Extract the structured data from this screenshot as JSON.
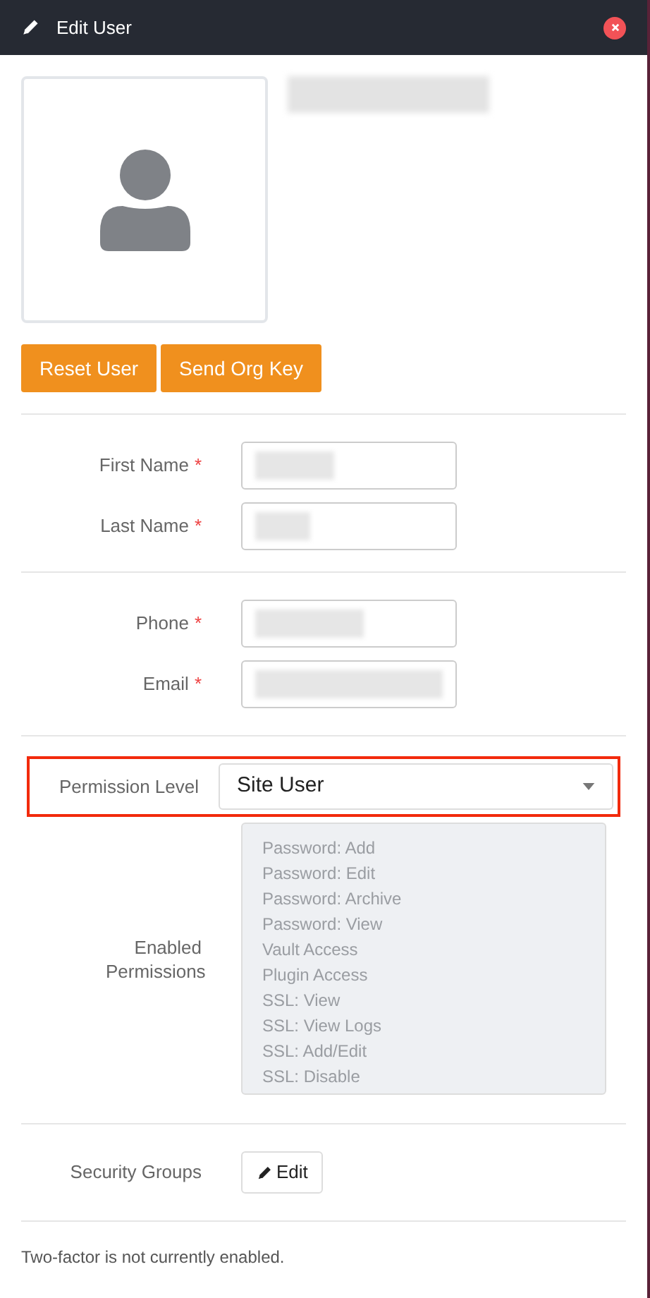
{
  "window": {
    "title": "Edit User"
  },
  "profile": {
    "name_redacted": true
  },
  "actions": [
    "Reset User",
    "Send Org Key"
  ],
  "field_groups": [
    [
      {
        "label": "First Name",
        "required_mark": "*",
        "redacted": true
      },
      {
        "label": "Last Name",
        "required_mark": "*",
        "redacted": true
      }
    ],
    [
      {
        "label": "Phone",
        "required_mark": "*",
        "redacted": true
      },
      {
        "label": "Email",
        "required_mark": "*",
        "redacted": true
      }
    ]
  ],
  "permission_level": {
    "label": "Permission Level",
    "value": "Site User",
    "highlighted": true
  },
  "enabled_permissions": {
    "label": "Enabled Permissions",
    "items": [
      "Password: Add",
      "Password: Edit",
      "Password: Archive",
      "Password: View",
      "Vault Access",
      "Plugin Access",
      "SSL: View",
      "SSL: View Logs",
      "SSL: Add/Edit",
      "SSL: Disable"
    ]
  },
  "security_groups": {
    "label": "Security Groups",
    "button": "Edit"
  },
  "two_factor": "Two-factor is not currently enabled."
}
